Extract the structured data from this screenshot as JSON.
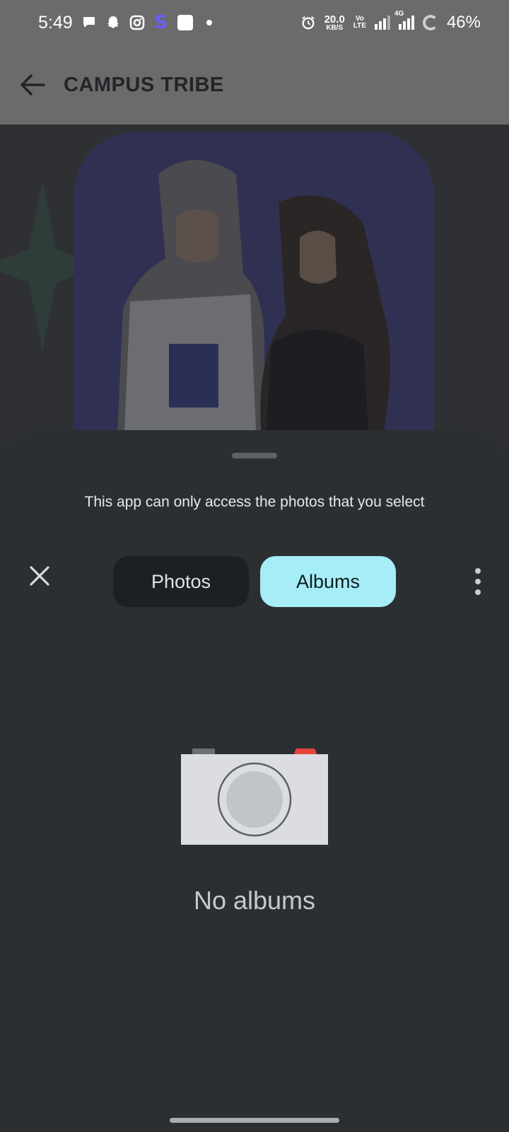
{
  "status_bar": {
    "time": "5:49",
    "net_speed_value": "20.0",
    "net_speed_unit": "KB/S",
    "volte_top": "Vo",
    "volte_bottom": "LTE",
    "network_type": "4G",
    "battery_percent": "46%",
    "icons": [
      "chat-bubble-icon",
      "snapchat-icon",
      "instagram-icon",
      "s-app-icon",
      "zomato-icon",
      "notification-dot-icon",
      "alarm-icon",
      "signal-icon",
      "signal-4g-icon",
      "battery-ring-icon"
    ],
    "s_app_glyph": "S"
  },
  "app_bar": {
    "title": "CAMPUS TRIBE",
    "back_icon": "arrow-back-icon"
  },
  "sheet": {
    "message": "This app can only access the photos that you select",
    "close_icon": "close-icon",
    "tabs": [
      {
        "label": "Photos",
        "selected": false
      },
      {
        "label": "Albums",
        "selected": true
      }
    ],
    "more_icon": "more-vert-icon",
    "empty_icon": "camera-icon",
    "empty_text": "No albums"
  },
  "colors": {
    "app_bar_scrim": "#6b6b6b",
    "sheet_bg": "#2c2f31",
    "tab_selected_bg": "#a6edf8",
    "tab_unselected_bg": "#1c2023",
    "camera_body": "#dcdde0",
    "camera_red": "#e8453c"
  }
}
